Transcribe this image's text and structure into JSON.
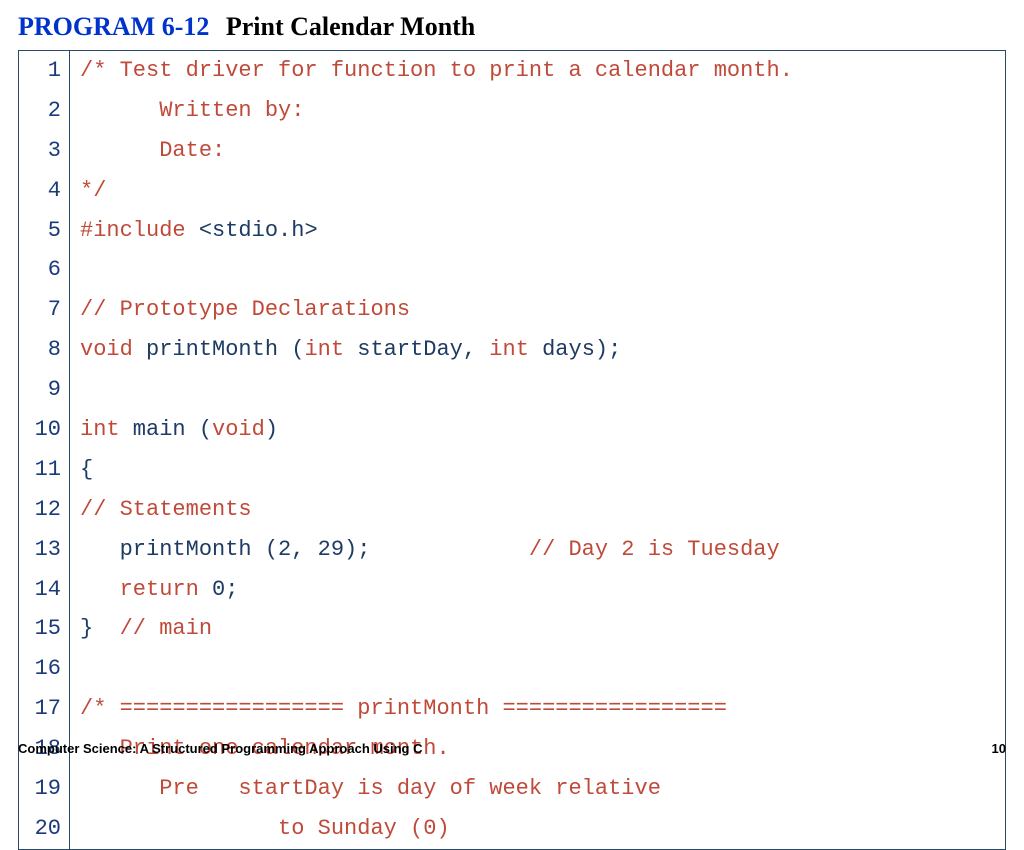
{
  "title": {
    "label": "PROGRAM 6-12",
    "name": "Print Calendar Month"
  },
  "code": {
    "lines": [
      {
        "n": 1,
        "segments": [
          {
            "cls": "comment",
            "t": "/* Test driver for function to print a calendar month."
          }
        ]
      },
      {
        "n": 2,
        "segments": [
          {
            "cls": "comment",
            "t": "      Written by:"
          }
        ]
      },
      {
        "n": 3,
        "segments": [
          {
            "cls": "comment",
            "t": "      Date:"
          }
        ]
      },
      {
        "n": 4,
        "segments": [
          {
            "cls": "comment",
            "t": "*/"
          }
        ]
      },
      {
        "n": 5,
        "segments": [
          {
            "cls": "keyword",
            "t": "#include "
          },
          {
            "cls": "text",
            "t": "<stdio.h>"
          }
        ]
      },
      {
        "n": 6,
        "segments": []
      },
      {
        "n": 7,
        "segments": [
          {
            "cls": "comment",
            "t": "// Prototype Declarations"
          }
        ]
      },
      {
        "n": 8,
        "segments": [
          {
            "cls": "type",
            "t": "void"
          },
          {
            "cls": "text",
            "t": " printMonth ("
          },
          {
            "cls": "type",
            "t": "int"
          },
          {
            "cls": "text",
            "t": " startDay, "
          },
          {
            "cls": "type",
            "t": "int"
          },
          {
            "cls": "text",
            "t": " days);"
          }
        ]
      },
      {
        "n": 9,
        "segments": []
      },
      {
        "n": 10,
        "segments": [
          {
            "cls": "type",
            "t": "int"
          },
          {
            "cls": "text",
            "t": " main ("
          },
          {
            "cls": "type",
            "t": "void"
          },
          {
            "cls": "text",
            "t": ")"
          }
        ]
      },
      {
        "n": 11,
        "segments": [
          {
            "cls": "text",
            "t": "{"
          }
        ]
      },
      {
        "n": 12,
        "segments": [
          {
            "cls": "comment",
            "t": "// Statements"
          }
        ]
      },
      {
        "n": 13,
        "segments": [
          {
            "cls": "text",
            "t": "   printMonth (2, 29);            "
          },
          {
            "cls": "comment",
            "t": "// Day 2 is Tuesday"
          }
        ]
      },
      {
        "n": 14,
        "segments": [
          {
            "cls": "text",
            "t": "   "
          },
          {
            "cls": "keyword",
            "t": "return"
          },
          {
            "cls": "text",
            "t": " 0;"
          }
        ]
      },
      {
        "n": 15,
        "segments": [
          {
            "cls": "text",
            "t": "}  "
          },
          {
            "cls": "comment",
            "t": "// main"
          }
        ]
      },
      {
        "n": 16,
        "segments": []
      },
      {
        "n": 17,
        "segments": [
          {
            "cls": "comment",
            "t": "/* ================= printMonth ================="
          }
        ]
      },
      {
        "n": 18,
        "segments": [
          {
            "cls": "comment",
            "t": "   Print one calendar month."
          }
        ]
      },
      {
        "n": 19,
        "segments": [
          {
            "cls": "comment",
            "t": "      Pre   startDay is day of week relative"
          }
        ]
      },
      {
        "n": 20,
        "segments": [
          {
            "cls": "comment",
            "t": "               to Sunday (0)"
          }
        ]
      }
    ]
  },
  "footer": {
    "left": "Computer Science: A Structured Programming Approach Using C",
    "right": "10"
  }
}
